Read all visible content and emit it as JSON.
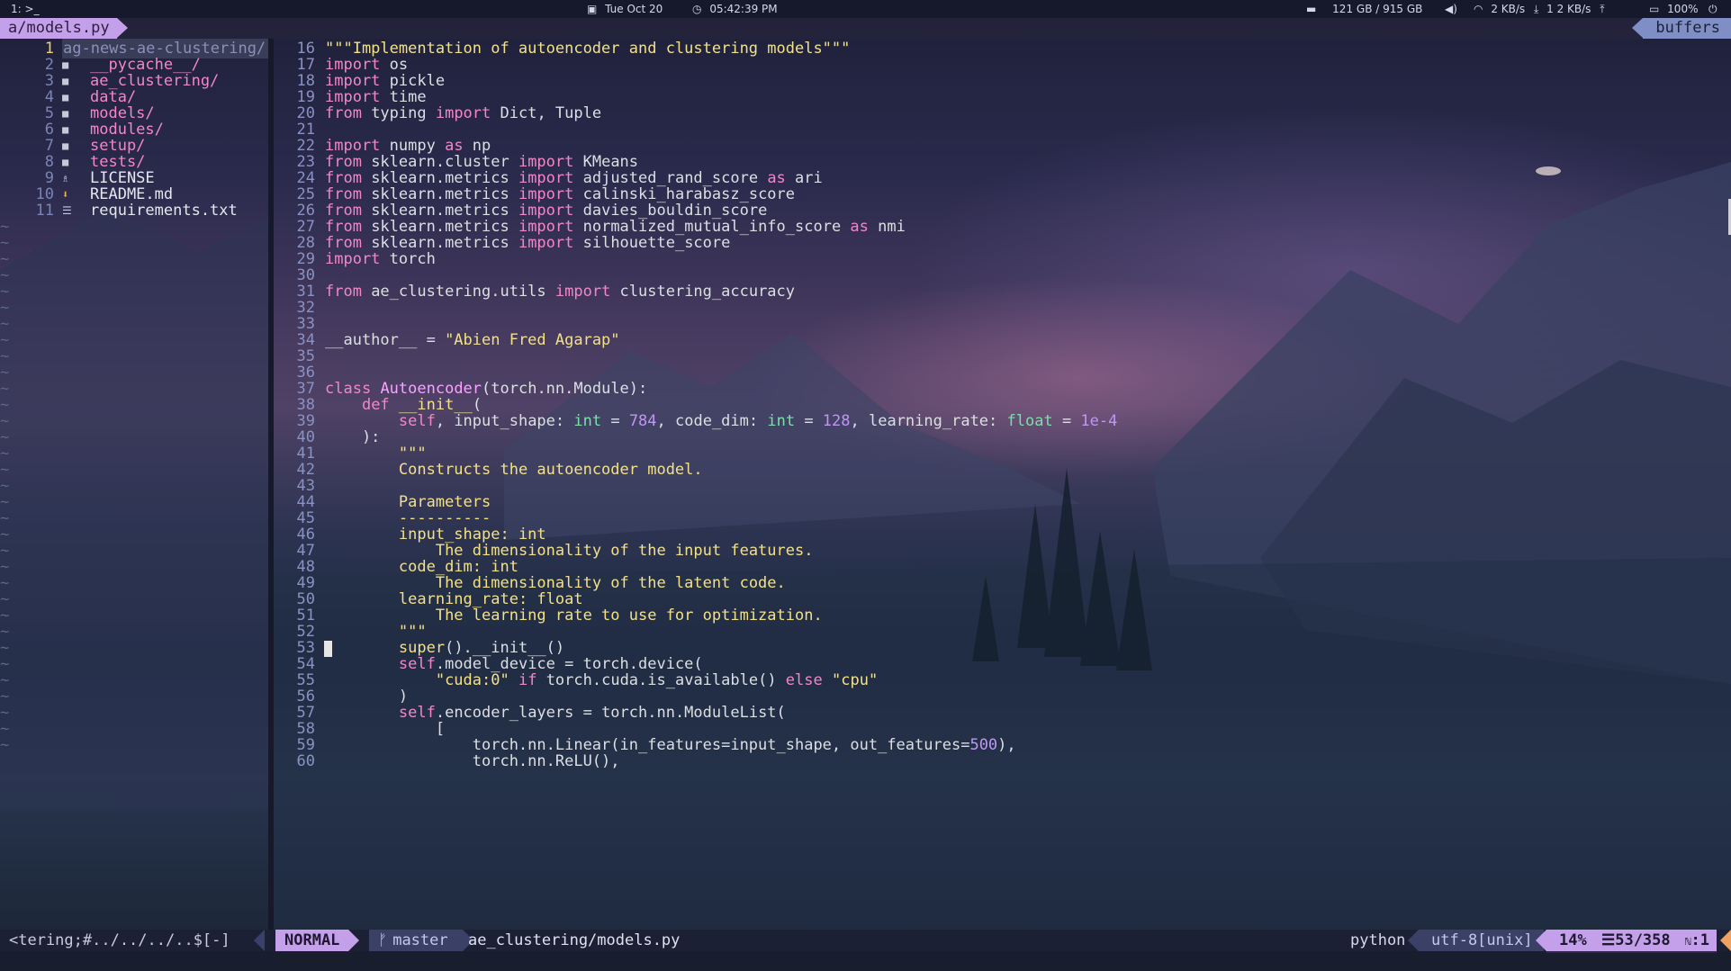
{
  "topbar": {
    "workspace": "1:",
    "terminal_glyph": ">_",
    "date": "Tue Oct 20",
    "time": "05:42:39 PM",
    "disk": "121 GB / 915 GB",
    "net_down": "2 KB/s",
    "net_up": "1 2 KB/s",
    "battery": "100%"
  },
  "tabline": {
    "file": "a/models.py",
    "buffers_label": "buffers"
  },
  "tree": {
    "root": "ag-news-ae-clustering/",
    "root_num": "1",
    "items": [
      {
        "num": "2",
        "name": "__pycache__/",
        "type": "dir",
        "icon": "folder-icon"
      },
      {
        "num": "3",
        "name": "ae_clustering/",
        "type": "dir",
        "icon": "folder-icon"
      },
      {
        "num": "4",
        "name": "data/",
        "type": "dir",
        "icon": "folder-icon"
      },
      {
        "num": "5",
        "name": "models/",
        "type": "dir",
        "icon": "folder-icon"
      },
      {
        "num": "6",
        "name": "modules/",
        "type": "dir",
        "icon": "folder-icon"
      },
      {
        "num": "7",
        "name": "setup/",
        "type": "dir",
        "icon": "folder-icon"
      },
      {
        "num": "8",
        "name": "tests/",
        "type": "dir",
        "icon": "folder-icon"
      },
      {
        "num": "9",
        "name": "LICENSE",
        "type": "file",
        "icon": "license-icon"
      },
      {
        "num": "10",
        "name": "README.md",
        "type": "file",
        "icon": "markdown-icon"
      },
      {
        "num": "11",
        "name": "requirements.txt",
        "type": "file",
        "icon": "text-file-icon"
      }
    ]
  },
  "code_lines": [
    {
      "n": "16",
      "t": [
        [
          "str",
          "\"\"\"Implementation of autoencoder and clustering models\"\"\""
        ]
      ]
    },
    {
      "n": "17",
      "t": [
        [
          "kw",
          "import"
        ],
        [
          "",
          " os"
        ]
      ]
    },
    {
      "n": "18",
      "t": [
        [
          "kw",
          "import"
        ],
        [
          "",
          " pickle"
        ]
      ]
    },
    {
      "n": "19",
      "t": [
        [
          "kw",
          "import"
        ],
        [
          "",
          " time"
        ]
      ]
    },
    {
      "n": "20",
      "t": [
        [
          "kw",
          "from"
        ],
        [
          "",
          " typing "
        ],
        [
          "kw",
          "import"
        ],
        [
          "",
          " Dict, Tuple"
        ]
      ]
    },
    {
      "n": "21",
      "t": []
    },
    {
      "n": "22",
      "t": [
        [
          "kw",
          "import"
        ],
        [
          "",
          " numpy "
        ],
        [
          "kw",
          "as"
        ],
        [
          "",
          " np"
        ]
      ]
    },
    {
      "n": "23",
      "t": [
        [
          "kw",
          "from"
        ],
        [
          "",
          " sklearn.cluster "
        ],
        [
          "kw",
          "import"
        ],
        [
          "",
          " KMeans"
        ]
      ]
    },
    {
      "n": "24",
      "t": [
        [
          "kw",
          "from"
        ],
        [
          "",
          " sklearn.metrics "
        ],
        [
          "kw",
          "import"
        ],
        [
          "",
          " adjusted_rand_score "
        ],
        [
          "kw",
          "as"
        ],
        [
          "",
          " ari"
        ]
      ]
    },
    {
      "n": "25",
      "t": [
        [
          "kw",
          "from"
        ],
        [
          "",
          " sklearn.metrics "
        ],
        [
          "kw",
          "import"
        ],
        [
          "",
          " calinski_harabasz_score"
        ]
      ]
    },
    {
      "n": "26",
      "t": [
        [
          "kw",
          "from"
        ],
        [
          "",
          " sklearn.metrics "
        ],
        [
          "kw",
          "import"
        ],
        [
          "",
          " davies_bouldin_score"
        ]
      ]
    },
    {
      "n": "27",
      "t": [
        [
          "kw",
          "from"
        ],
        [
          "",
          " sklearn.metrics "
        ],
        [
          "kw",
          "import"
        ],
        [
          "",
          " normalized_mutual_info_score "
        ],
        [
          "kw",
          "as"
        ],
        [
          "",
          " nmi"
        ]
      ]
    },
    {
      "n": "28",
      "t": [
        [
          "kw",
          "from"
        ],
        [
          "",
          " sklearn.metrics "
        ],
        [
          "kw",
          "import"
        ],
        [
          "",
          " silhouette_score"
        ]
      ]
    },
    {
      "n": "29",
      "t": [
        [
          "kw",
          "import"
        ],
        [
          "",
          " torch"
        ]
      ]
    },
    {
      "n": "30",
      "t": []
    },
    {
      "n": "31",
      "t": [
        [
          "kw",
          "from"
        ],
        [
          "",
          " ae_clustering.utils "
        ],
        [
          "kw",
          "import"
        ],
        [
          "",
          " clustering_accuracy"
        ]
      ]
    },
    {
      "n": "32",
      "t": []
    },
    {
      "n": "33",
      "t": []
    },
    {
      "n": "34",
      "t": [
        [
          "",
          "__author__ = "
        ],
        [
          "str",
          "\"Abien Fred Agarap\""
        ]
      ]
    },
    {
      "n": "35",
      "t": []
    },
    {
      "n": "36",
      "t": []
    },
    {
      "n": "37",
      "t": [
        [
          "kw",
          "class"
        ],
        [
          "",
          " "
        ],
        [
          "cls",
          "Autoencoder"
        ],
        [
          "",
          "(torch.nn.Module):"
        ]
      ]
    },
    {
      "n": "38",
      "t": [
        [
          "",
          "    "
        ],
        [
          "kw",
          "def"
        ],
        [
          "",
          " "
        ],
        [
          "fn",
          "__init__"
        ],
        [
          "",
          "("
        ]
      ]
    },
    {
      "n": "39",
      "t": [
        [
          "",
          "        "
        ],
        [
          "kw",
          "self"
        ],
        [
          "",
          ", input_shape: "
        ],
        [
          "ty",
          "int"
        ],
        [
          "",
          " = "
        ],
        [
          "num",
          "784"
        ],
        [
          "",
          ", code_dim: "
        ],
        [
          "ty",
          "int"
        ],
        [
          "",
          " = "
        ],
        [
          "num",
          "128"
        ],
        [
          "",
          ", learning_rate: "
        ],
        [
          "ty",
          "float"
        ],
        [
          "",
          " = "
        ],
        [
          "num",
          "1e-4"
        ]
      ]
    },
    {
      "n": "40",
      "t": [
        [
          "",
          "    ):"
        ]
      ]
    },
    {
      "n": "41",
      "t": [
        [
          "",
          "        "
        ],
        [
          "str",
          "\"\"\""
        ]
      ]
    },
    {
      "n": "42",
      "t": [
        [
          "",
          "        "
        ],
        [
          "str",
          "Constructs the autoencoder model."
        ]
      ]
    },
    {
      "n": "43",
      "t": []
    },
    {
      "n": "44",
      "t": [
        [
          "",
          "        "
        ],
        [
          "str",
          "Parameters"
        ]
      ]
    },
    {
      "n": "45",
      "t": [
        [
          "",
          "        "
        ],
        [
          "str",
          "----------"
        ]
      ]
    },
    {
      "n": "46",
      "t": [
        [
          "",
          "        "
        ],
        [
          "str",
          "input_shape: int"
        ]
      ]
    },
    {
      "n": "47",
      "t": [
        [
          "",
          "            "
        ],
        [
          "str",
          "The dimensionality of the input features."
        ]
      ]
    },
    {
      "n": "48",
      "t": [
        [
          "",
          "        "
        ],
        [
          "str",
          "code_dim: int"
        ]
      ]
    },
    {
      "n": "49",
      "t": [
        [
          "",
          "            "
        ],
        [
          "str",
          "The dimensionality of the latent code."
        ]
      ]
    },
    {
      "n": "50",
      "t": [
        [
          "",
          "        "
        ],
        [
          "str",
          "learning_rate: float"
        ]
      ]
    },
    {
      "n": "51",
      "t": [
        [
          "",
          "            "
        ],
        [
          "str",
          "The learning rate to use for optimization."
        ]
      ]
    },
    {
      "n": "52",
      "t": [
        [
          "",
          "        "
        ],
        [
          "str",
          "\"\"\""
        ]
      ]
    },
    {
      "n": "53",
      "t": [
        [
          "",
          "        "
        ],
        [
          "fn",
          "super"
        ],
        [
          "",
          "().__init__()"
        ]
      ],
      "cursor": true
    },
    {
      "n": "54",
      "t": [
        [
          "",
          "        "
        ],
        [
          "kw",
          "self"
        ],
        [
          "",
          ".model_device = torch.device("
        ]
      ]
    },
    {
      "n": "55",
      "t": [
        [
          "",
          "            "
        ],
        [
          "str",
          "\"cuda:0\""
        ],
        [
          "",
          " "
        ],
        [
          "kw",
          "if"
        ],
        [
          "",
          " torch.cuda.is_available() "
        ],
        [
          "kw",
          "else"
        ],
        [
          "",
          " "
        ],
        [
          "str",
          "\"cpu\""
        ]
      ]
    },
    {
      "n": "56",
      "t": [
        [
          "",
          "        )"
        ]
      ]
    },
    {
      "n": "57",
      "t": [
        [
          "",
          "        "
        ],
        [
          "kw",
          "self"
        ],
        [
          "",
          ".encoder_layers = torch.nn.ModuleList("
        ]
      ]
    },
    {
      "n": "58",
      "t": [
        [
          "",
          "            ["
        ]
      ]
    },
    {
      "n": "59",
      "t": [
        [
          "",
          "                torch.nn.Linear(in_features=input_shape, out_features="
        ],
        [
          "num",
          "500"
        ],
        [
          "",
          "),"
        ]
      ]
    },
    {
      "n": "60",
      "t": [
        [
          "",
          "                torch.nn.ReLU(),"
        ]
      ]
    }
  ],
  "statusline": {
    "left_path": "<tering;#../../../..$[-]",
    "mode": "NORMAL",
    "branch_glyph": "ᚠ",
    "branch": "master",
    "file": "ae_clustering/models.py",
    "filetype": "python",
    "encoding": "utf-8[unix]",
    "percent": "14%",
    "line_glyph": "☰",
    "position": "53/358",
    "column_prefix": "ℕ",
    "column": ":1"
  },
  "colors": {
    "mode_accent": "#c5a0ea",
    "keyword": "#f088c8",
    "string": "#f2e08a",
    "number": "#c195f5",
    "type": "#79e0a9"
  }
}
